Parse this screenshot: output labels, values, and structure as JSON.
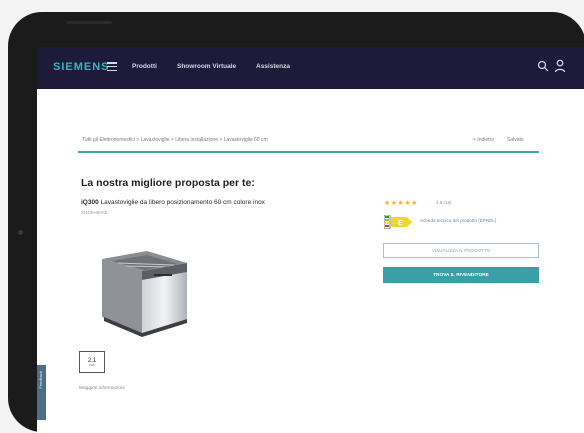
{
  "header": {
    "brand": "SIEMENS",
    "nav": [
      "Prodotti",
      "Showroom Virtuale",
      "Assistenza"
    ],
    "icons": [
      "menu-icon",
      "search-icon",
      "user-icon"
    ],
    "bg_color": "#1d1a3a",
    "brand_color": "#2fb7c2"
  },
  "breadcrumb": {
    "path": "Tutti gli Elettrodomestici > Lavastoviglie > Libera installazione > Lavastoviglie 60 cm",
    "right": [
      "< Indietro",
      "Salvato"
    ]
  },
  "product": {
    "heading": "La nostra migliore proposta per te:",
    "series": "iQ300",
    "name": "Lavastoviglie da libero posizionamento 60 cm colore inox",
    "code": "SN23HI60AE",
    "energy_badge": {
      "value": "2.1",
      "unit": "kWh"
    },
    "more_info": "Maggiori informazioni"
  },
  "rating": {
    "stars": "★★★★★",
    "value": 4.5,
    "text": "4.6 (16)"
  },
  "energy": {
    "class": "E",
    "info": "Scheda tecnica del prodotto (EPREL)"
  },
  "actions": {
    "secondary": "VISUALIZZA IL PRODOTTO",
    "primary": "TROVA IL RIVENDITORE",
    "accent_color": "#3aa0a6"
  },
  "feedback": {
    "label": "Feedback"
  }
}
